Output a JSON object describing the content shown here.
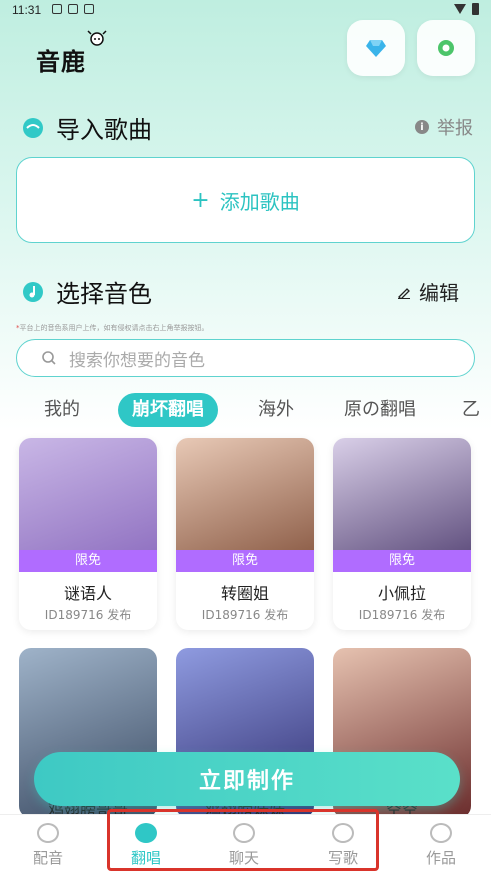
{
  "status_bar": {
    "time": "11:31"
  },
  "app": {
    "logo_text": "音鹿"
  },
  "import_section": {
    "title": "导入歌曲",
    "report_label": "举报",
    "add_label": "添加歌曲"
  },
  "voice_section": {
    "title": "选择音色",
    "edit_label": "编辑",
    "notice_star": "*",
    "notice_text": "平台上的音色系用户上传，如有侵权请点击右上角举报按钮。",
    "search_placeholder": "搜索你想要的音色"
  },
  "tabs": [
    {
      "label": "我的"
    },
    {
      "label": "崩坏翻唱",
      "active": true
    },
    {
      "label": "海外"
    },
    {
      "label": "原の翻唱"
    },
    {
      "label": "乙"
    }
  ],
  "cards": [
    {
      "badge": "限免",
      "name": "谜语人",
      "publisher": "ID189716 发布",
      "color_top": "#c9b7e6",
      "color_bottom": "#8e6fc0"
    },
    {
      "badge": "限免",
      "name": "转圈姐",
      "publisher": "ID189716 发布",
      "color_top": "#e8c9b6",
      "color_bottom": "#8a5a44"
    },
    {
      "badge": "限免",
      "name": "小佩拉",
      "publisher": "ID189716 发布",
      "color_top": "#d9cfe8",
      "color_bottom": "#5b4a7a"
    }
  ],
  "cards_row2": [
    {
      "name": "鸡翅膀哥哥",
      "color_top": "#9fb3c9",
      "color_bottom": "#3a4a62"
    },
    {
      "name": "鸡翅膀妹妹",
      "color_top": "#8f9be0",
      "color_bottom": "#2e2c6e"
    },
    {
      "name": "空空",
      "color_top": "#e6c2b0",
      "color_bottom": "#6a2c2c"
    }
  ],
  "cta_label": "立即制作",
  "bottom_nav": [
    {
      "label": "配音",
      "icon": "mic-icon"
    },
    {
      "label": "翻唱",
      "icon": "mic-icon",
      "active": true
    },
    {
      "label": "聊天",
      "icon": "chat-icon"
    },
    {
      "label": "写歌",
      "icon": "disc-icon"
    },
    {
      "label": "作品",
      "icon": "headphones-icon"
    }
  ],
  "colors": {
    "accent": "#2fc7c6",
    "badge": "#b06cff",
    "highlight_box": "#d9342b"
  }
}
